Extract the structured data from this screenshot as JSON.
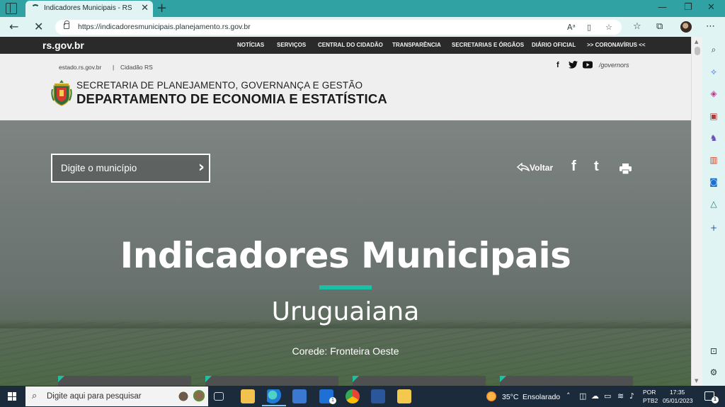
{
  "browser": {
    "tab_title": "Indicadores Municipais - RS",
    "url": "https://indicadoresmunicipais.planejamento.rs.gov.br"
  },
  "site": {
    "brand": "rs.gov.br",
    "nav": [
      "NOTÍCIAS",
      "SERVIÇOS",
      "CENTRAL DO CIDADÃO",
      "TRANSPARÊNCIA",
      "SECRETARIAS E ÓRGÃOS",
      "DIÁRIO OFICIAL",
      ">> CORONAVÍRUS <<"
    ],
    "breadcrumb": [
      "estado.rs.gov.br",
      "|",
      "Cidadão RS"
    ],
    "social_handle": "/governors",
    "secretaria": "SECRETARIA DE PLANEJAMENTO, GOVERNANÇA E GESTÃO",
    "departamento": "DEPARTAMENTO DE ECONOMIA E ESTATÍSTICA"
  },
  "hero": {
    "search_placeholder": "Digite o município",
    "back_label": "Voltar",
    "title": "Indicadores Municipais",
    "city": "Uruguaiana",
    "corede": "Corede: Fronteira Oeste",
    "accent_color": "#19c0a5"
  },
  "taskbar": {
    "search_placeholder": "Digite aqui para pesquisar",
    "weather_temp": "35°C",
    "weather_desc": "Ensolarado",
    "lang_line1": "POR",
    "lang_line2": "PTB2",
    "time": "17:35",
    "date": "05/01/2023",
    "mail_badge": "1",
    "notif_badge": "1"
  }
}
